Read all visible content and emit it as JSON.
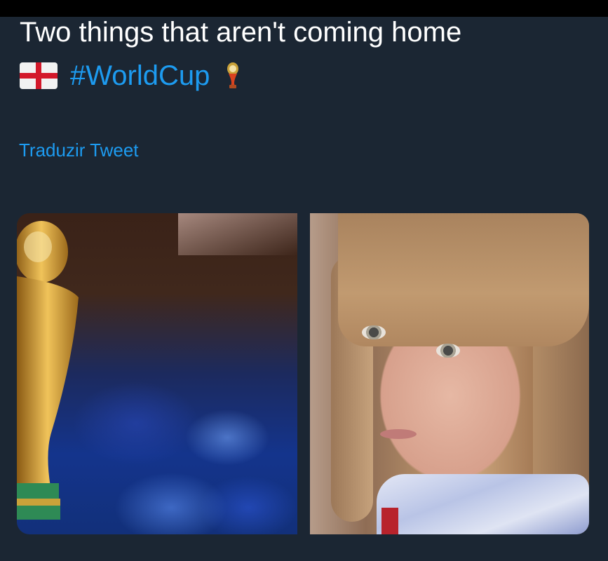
{
  "tweet": {
    "text_line1": "Two things that aren't coming home",
    "hashtag": "#WorldCup",
    "translate_link": "Traduzir Tweet"
  },
  "icons": {
    "flag": "england-flag-icon",
    "emoji": "world-cup-trophy-emoji"
  },
  "colors": {
    "background": "#1b2633",
    "text": "#ffffff",
    "link": "#1d9bf0"
  }
}
